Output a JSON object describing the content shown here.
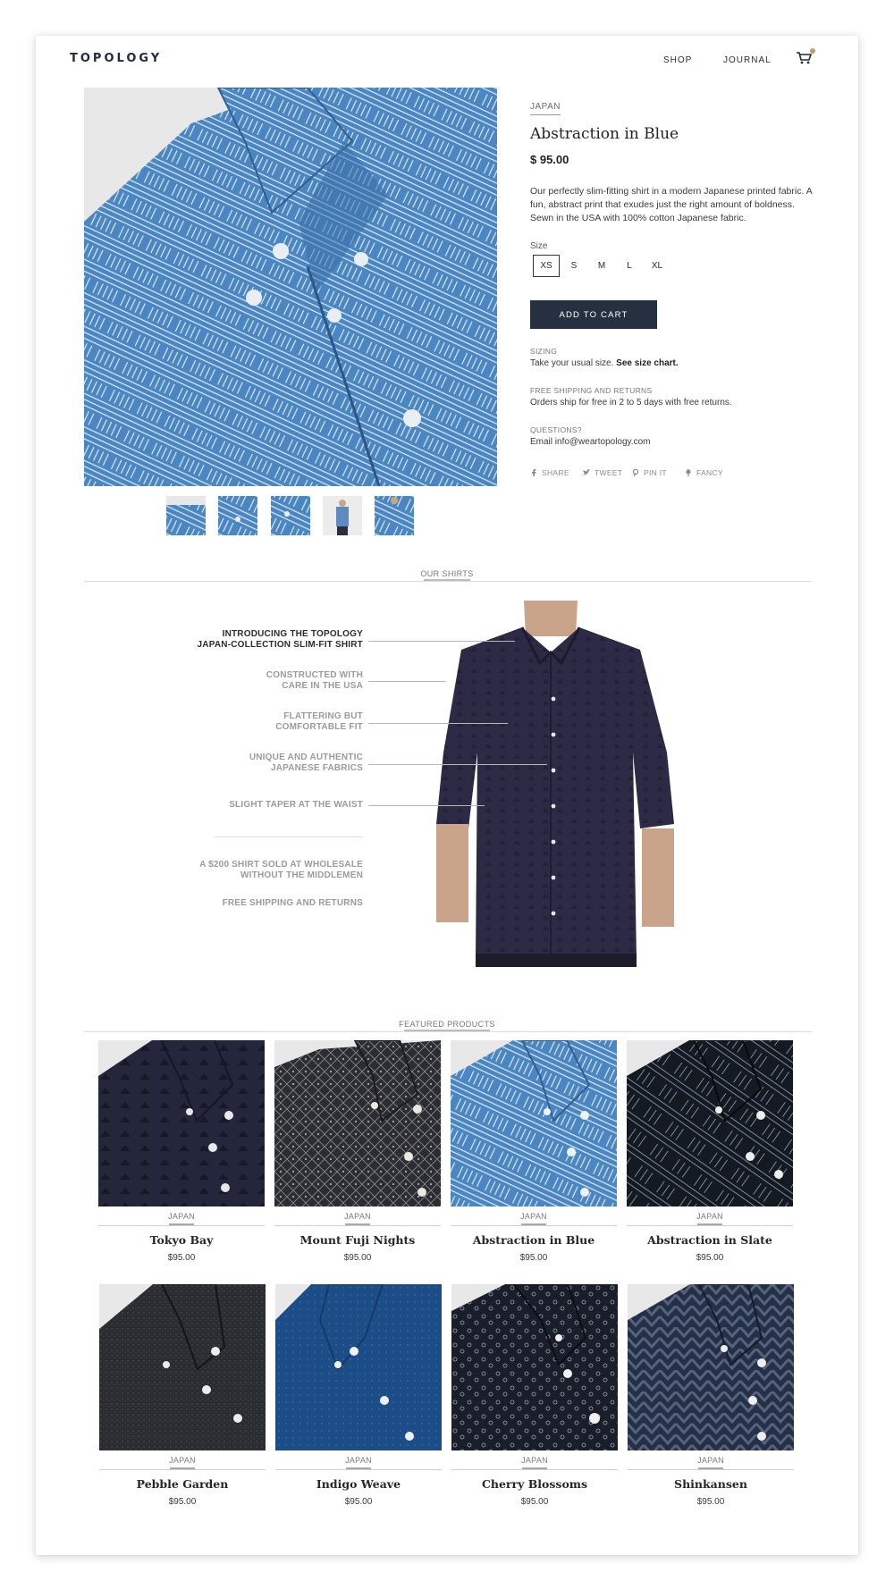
{
  "header": {
    "logo": "TOPOLOGY",
    "nav": [
      "SHOP",
      "JOURNAL"
    ],
    "cart_icon": "cart-icon",
    "cart_dot_color": "#c39a6b"
  },
  "product": {
    "collection": "JAPAN",
    "title": "Abstraction in Blue",
    "price": "$ 95.00",
    "description": "Our perfectly slim-fitting shirt in a modern Japanese printed fabric. A fun, abstract print that exudes just the right amount of boldness. Sewn in the USA with 100% cotton Japanese fabric.",
    "size_label": "Size",
    "sizes": [
      "XS",
      "S",
      "M",
      "L",
      "XL"
    ],
    "selected_size": "XS",
    "add_to_cart": "ADD TO CART",
    "sizing_heading": "SIZING",
    "sizing_text": "Take your usual size.",
    "sizing_link": "See size chart.",
    "shipping_heading": "FREE SHIPPING AND RETURNS",
    "shipping_text": "Orders ship for free in 2 to 5 days with free returns.",
    "questions_heading": "QUESTIONS?",
    "questions_text": "Email info@weartopology.com",
    "share": [
      "SHARE",
      "TWEET",
      "PIN IT",
      "FANCY"
    ],
    "accent_color": "#273040"
  },
  "our_shirts": {
    "title": "OUR SHIRTS",
    "features": [
      {
        "line1": "INTRODUCING THE TOPOLOGY",
        "line2": "JAPAN-COLLECTION SLIM-FIT SHIRT"
      },
      {
        "line1": "CONSTRUCTED WITH",
        "line2": "CARE IN THE USA"
      },
      {
        "line1": "FLATTERING BUT",
        "line2": "COMFORTABLE FIT"
      },
      {
        "line1": "UNIQUE AND AUTHENTIC",
        "line2": "JAPANESE FABRICS"
      },
      {
        "line1": "SLIGHT TAPER AT THE WAIST"
      }
    ],
    "extras": [
      {
        "line1": "A $200 SHIRT SOLD AT WHOLESALE",
        "line2": "WITHOUT THE MIDDLEMEN"
      },
      {
        "line1": "FREE SHIPPING AND RETURNS"
      }
    ]
  },
  "featured": {
    "title": "FEATURED PRODUCTS",
    "products": [
      {
        "category": "JAPAN",
        "name": "Tokyo Bay",
        "price": "$95.00"
      },
      {
        "category": "JAPAN",
        "name": "Mount Fuji Nights",
        "price": "$95.00"
      },
      {
        "category": "JAPAN",
        "name": "Abstraction in Blue",
        "price": "$95.00"
      },
      {
        "category": "JAPAN",
        "name": "Abstraction in Slate",
        "price": "$95.00"
      },
      {
        "category": "JAPAN",
        "name": "Pebble Garden",
        "price": "$95.00"
      },
      {
        "category": "JAPAN",
        "name": "Indigo Weave",
        "price": "$95.00"
      },
      {
        "category": "JAPAN",
        "name": "Cherry Blossoms",
        "price": "$95.00"
      },
      {
        "category": "JAPAN",
        "name": "Shinkansen",
        "price": "$95.00"
      }
    ]
  }
}
